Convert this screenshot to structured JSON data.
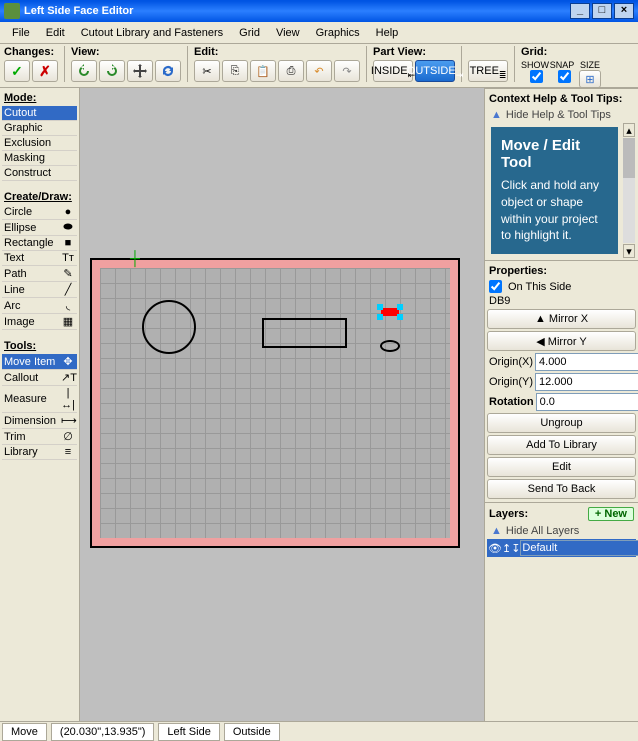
{
  "window": {
    "title": "Left Side Face Editor"
  },
  "menu": [
    "File",
    "Edit",
    "Cutout Library and Fasteners",
    "Grid",
    "View",
    "Graphics",
    "Help"
  ],
  "toolbar": {
    "changes": "Changes:",
    "view": "View:",
    "edit": "Edit:",
    "partview": "Part View:",
    "grid": "Grid:",
    "inside": "INSIDE",
    "outside": "OUTSIDE",
    "tree": "TREE",
    "gridShow": "SHOW",
    "gridSnap": "SNAP",
    "gridSize": "SIZE"
  },
  "mode": {
    "head": "Mode:",
    "items": [
      "Cutout",
      "Graphic",
      "Exclusion",
      "Masking",
      "Construct"
    ],
    "selected": 0
  },
  "draw": {
    "head": "Create/Draw:",
    "items": [
      {
        "label": "Circle",
        "icon": "●"
      },
      {
        "label": "Ellipse",
        "icon": "⬬"
      },
      {
        "label": "Rectangle",
        "icon": "■"
      },
      {
        "label": "Text",
        "icon": "Tᴛ"
      },
      {
        "label": "Path",
        "icon": "✎"
      },
      {
        "label": "Line",
        "icon": "╱"
      },
      {
        "label": "Arc",
        "icon": "◟"
      },
      {
        "label": "Image",
        "icon": "▦"
      }
    ]
  },
  "tools": {
    "head": "Tools:",
    "items": [
      {
        "label": "Move Item",
        "icon": "✥"
      },
      {
        "label": "Callout",
        "icon": "↗T"
      },
      {
        "label": "Measure",
        "icon": "|↔|"
      },
      {
        "label": "Dimension",
        "icon": "⟼"
      },
      {
        "label": "Trim",
        "icon": "∅"
      },
      {
        "label": "Library",
        "icon": "≡"
      }
    ],
    "selected": 0
  },
  "context": {
    "head": "Context Help & Tool Tips:",
    "hide": "Hide Help & Tool Tips",
    "title": "Move / Edit Tool",
    "body": "Click and hold any object or shape within your project to highlight it."
  },
  "props": {
    "head": "Properties:",
    "onThisSide": "On This Side",
    "objName": "DB9",
    "mirrorX": "Mirror X",
    "mirrorY": "Mirror Y",
    "originXLabel": "Origin(X)",
    "originYLabel": "Origin(Y)",
    "originX": "4.000",
    "originY": "12.000",
    "rotationLabel": "Rotation",
    "rotation": "0.0",
    "ungroup": "Ungroup",
    "addLib": "Add To Library",
    "edit": "Edit",
    "sendBack": "Send To Back"
  },
  "layers": {
    "head": "Layers:",
    "new": "+ New",
    "hide": "Hide All Layers",
    "default": "Default"
  },
  "status": {
    "mode": "Move",
    "coords": "(20.030\",13.935\")",
    "side": "Left Side",
    "view": "Outside"
  }
}
